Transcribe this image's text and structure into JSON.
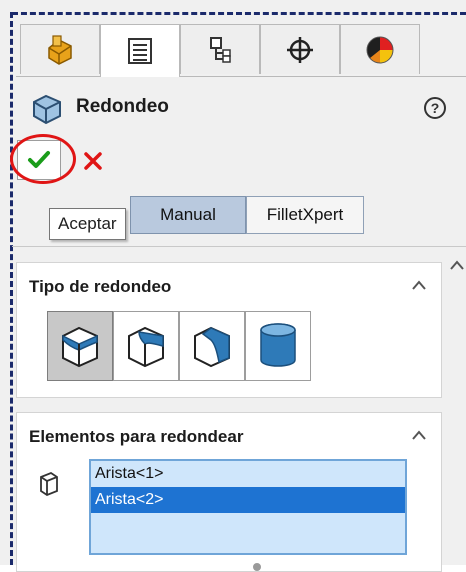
{
  "tabs": [
    {
      "icon": "feature-tree-icon",
      "active": false
    },
    {
      "icon": "property-manager-icon",
      "active": true
    },
    {
      "icon": "configuration-manager-icon",
      "active": false
    },
    {
      "icon": "dimxpert-icon",
      "active": false
    },
    {
      "icon": "display-manager-icon",
      "active": false
    }
  ],
  "header": {
    "title": "Redondeo",
    "icon": "fillet-feature-icon",
    "help_icon": "help-icon",
    "help_glyph": "?"
  },
  "actions": {
    "ok_icon": "checkmark-icon",
    "cancel_icon": "close-icon",
    "highlight_color": "#e01515"
  },
  "tooltip": {
    "text": "Aceptar"
  },
  "mode_toggle": {
    "options": [
      "Manual",
      "FilletXpert"
    ],
    "selected": "Manual"
  },
  "fillet_type": {
    "title": "Tipo de redondeo",
    "options": [
      "constant-size-fillet-icon",
      "variable-size-fillet-icon",
      "face-fillet-icon",
      "full-round-fillet-icon"
    ],
    "selected_index": 0
  },
  "items_to_fillet": {
    "title": "Elementos para redondear",
    "items": [
      "Arista<1>",
      "Arista<2>"
    ],
    "selected_index": 1
  },
  "colors": {
    "accent": "#1e73d2",
    "list_bg": "#cfe6fb",
    "ok_green": "#1a9c1a",
    "cancel_red": "#e01515",
    "outline": "#1b2a6b"
  }
}
